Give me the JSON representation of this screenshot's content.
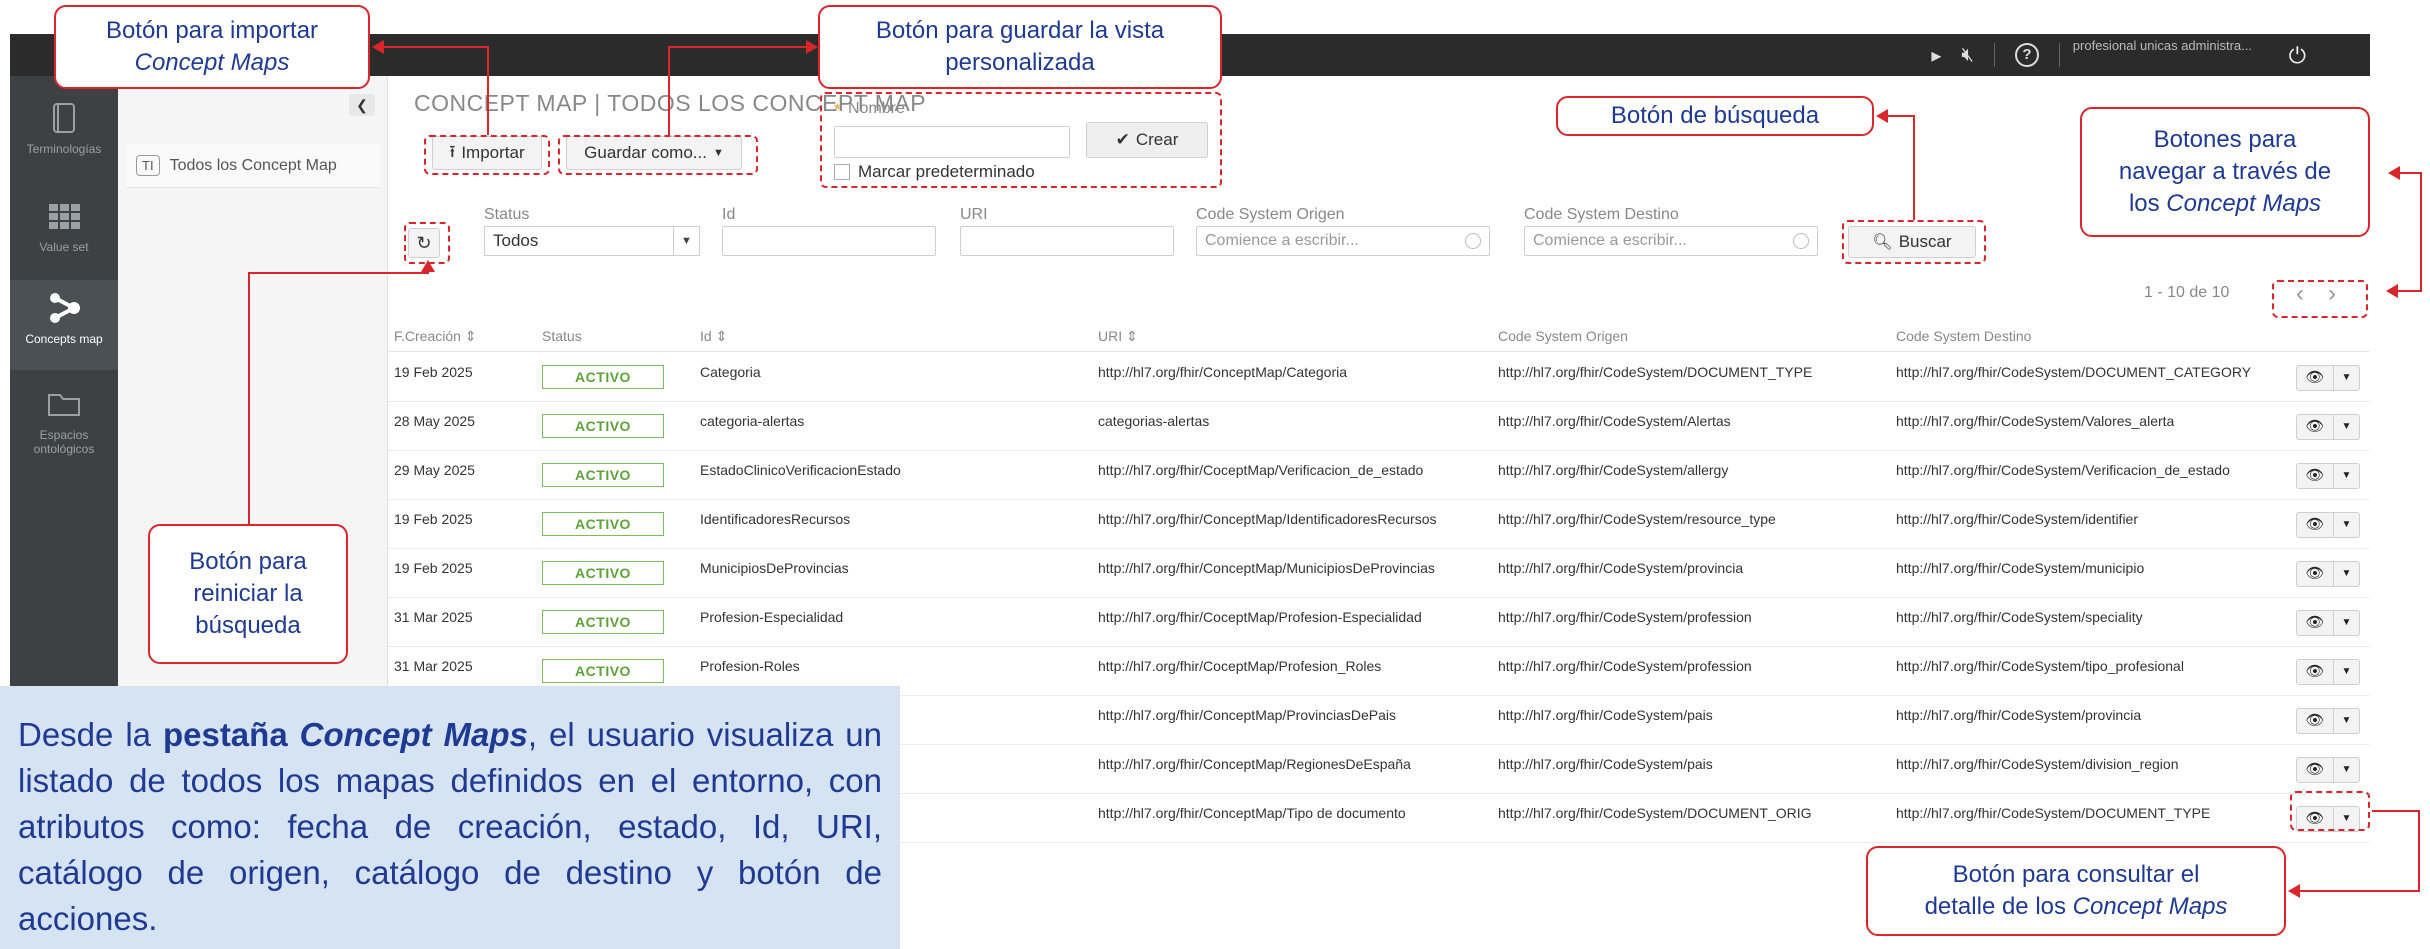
{
  "topbar": {
    "user": "profesional unicas administra...",
    "icon_play": "play-icon",
    "icon_mute": "mic-off-icon",
    "icon_help": "help-icon",
    "icon_power": "power-icon"
  },
  "rail": {
    "items": [
      {
        "label": "Terminologías",
        "icon": "book-icon",
        "active": false
      },
      {
        "label": "Value set",
        "icon": "grid-icon",
        "active": false
      },
      {
        "label": "Concepts map",
        "icon": "share-nodes-icon",
        "active": true
      },
      {
        "label": "Espacios ontológicos",
        "icon": "folder-icon",
        "active": false
      }
    ]
  },
  "lpanel": {
    "badge": "TI",
    "item_label": "Todos los Concept Map"
  },
  "main": {
    "title": "CONCEPT MAP | TODOS LOS CONCEPT MAP",
    "import_label": "Importar",
    "save_as_label": "Guardar como...",
    "save_form": {
      "required_mark": "*",
      "name_label": "Nombre",
      "name_value": "",
      "create_label": "Crear",
      "default_label": "Marcar predeterminado"
    }
  },
  "filters": {
    "status_label": "Status",
    "status_value": "Todos",
    "id_label": "Id",
    "uri_label": "URI",
    "origin_label": "Code System Origen",
    "origin_placeholder": "Comience a escribir...",
    "dest_label": "Code System Destino",
    "dest_placeholder": "Comience a escribir...",
    "search_label": "Buscar"
  },
  "pager": {
    "count": "1 - 10 de 10"
  },
  "table": {
    "headers": [
      "F.Creación ⇕",
      "Status",
      "Id ⇕",
      "URI ⇕",
      "Code System Origen",
      "Code System Destino"
    ],
    "rows": [
      {
        "date": "19 Feb 2025",
        "status": "ACTIVO",
        "id": "Categoria",
        "uri": "http://hl7.org/fhir/ConceptMap/Categoria",
        "origin": "http://hl7.org/fhir/CodeSystem/DOCUMENT_TYPE",
        "dest": "http://hl7.org/fhir/CodeSystem/DOCUMENT_CATEGORY"
      },
      {
        "date": "28 May 2025",
        "status": "ACTIVO",
        "id": "categoria-alertas",
        "uri": "categorias-alertas",
        "origin": "http://hl7.org/fhir/CodeSystem/Alertas",
        "dest": "http://hl7.org/fhir/CodeSystem/Valores_alerta"
      },
      {
        "date": "29 May 2025",
        "status": "ACTIVO",
        "id": "EstadoClinicoVerificacionEstado",
        "uri": "http://hl7.org/fhir/CoceptMap/Verificacion_de_estado",
        "origin": "http://hl7.org/fhir/CodeSystem/allergy",
        "dest": "http://hl7.org/fhir/CodeSystem/Verificacion_de_estado"
      },
      {
        "date": "19 Feb 2025",
        "status": "ACTIVO",
        "id": "IdentificadoresRecursos",
        "uri": "http://hl7.org/fhir/ConceptMap/IdentificadoresRecursos",
        "origin": "http://hl7.org/fhir/CodeSystem/resource_type",
        "dest": "http://hl7.org/fhir/CodeSystem/identifier"
      },
      {
        "date": "19 Feb 2025",
        "status": "ACTIVO",
        "id": "MunicipiosDeProvincias",
        "uri": "http://hl7.org/fhir/ConceptMap/MunicipiosDeProvincias",
        "origin": "http://hl7.org/fhir/CodeSystem/provincia",
        "dest": "http://hl7.org/fhir/CodeSystem/municipio"
      },
      {
        "date": "31 Mar 2025",
        "status": "ACTIVO",
        "id": "Profesion-Especialidad",
        "uri": "http://hl7.org/fhir/CoceptMap/Profesion-Especialidad",
        "origin": "http://hl7.org/fhir/CodeSystem/profession",
        "dest": "http://hl7.org/fhir/CodeSystem/speciality"
      },
      {
        "date": "31 Mar 2025",
        "status": "ACTIVO",
        "id": "Profesion-Roles",
        "uri": "http://hl7.org/fhir/CoceptMap/Profesion_Roles",
        "origin": "http://hl7.org/fhir/CodeSystem/profession",
        "dest": "http://hl7.org/fhir/CodeSystem/tipo_profesional"
      },
      {
        "date": "",
        "status": "",
        "id": "",
        "uri": "http://hl7.org/fhir/ConceptMap/ProvinciasDePais",
        "origin": "http://hl7.org/fhir/CodeSystem/pais",
        "dest": "http://hl7.org/fhir/CodeSystem/provincia"
      },
      {
        "date": "",
        "status": "",
        "id": "",
        "uri": "http://hl7.org/fhir/ConceptMap/RegionesDeEspaña",
        "origin": "http://hl7.org/fhir/CodeSystem/pais",
        "dest": "http://hl7.org/fhir/CodeSystem/division_region"
      },
      {
        "date": "",
        "status": "",
        "id": "",
        "uri": "http://hl7.org/fhir/ConceptMap/Tipo de documento",
        "origin": "http://hl7.org/fhir/CodeSystem/DOCUMENT_ORIG",
        "dest": "http://hl7.org/fhir/CodeSystem/DOCUMENT_TYPE"
      }
    ]
  },
  "annotations": {
    "import_title": "Botón para importar",
    "import_em": "Concept Maps",
    "save_title": "Botón para guardar la vista",
    "save_title2": "personalizada",
    "search_title": "Botón de búsqueda",
    "nav_title": "Botones para",
    "nav_title2": "navegar a través de",
    "nav_pre": "los ",
    "nav_em": "Concept Maps",
    "reset_1": "Botón para",
    "reset_2": "reiniciar la",
    "reset_3": "búsqueda",
    "detail_title": "Botón para consultar el",
    "detail_pre": "detalle de los ",
    "detail_em": "Concept Maps",
    "desc_p1": "Desde la ",
    "desc_b1": "pestaña ",
    "desc_bi": "Concept Maps",
    "desc_p2": ", el usuario visualiza un listado de todos los mapas definidos en el entorno, con atributos como: fecha de creación, estado, Id, URI, catálogo de origen, catálogo de destino y botón de acciones."
  },
  "colors": {
    "annotation_red": "#d9262b",
    "annotation_blue": "#1f3a93",
    "status_green": "#5ea33a",
    "desc_bg": "#d5e3f3"
  }
}
